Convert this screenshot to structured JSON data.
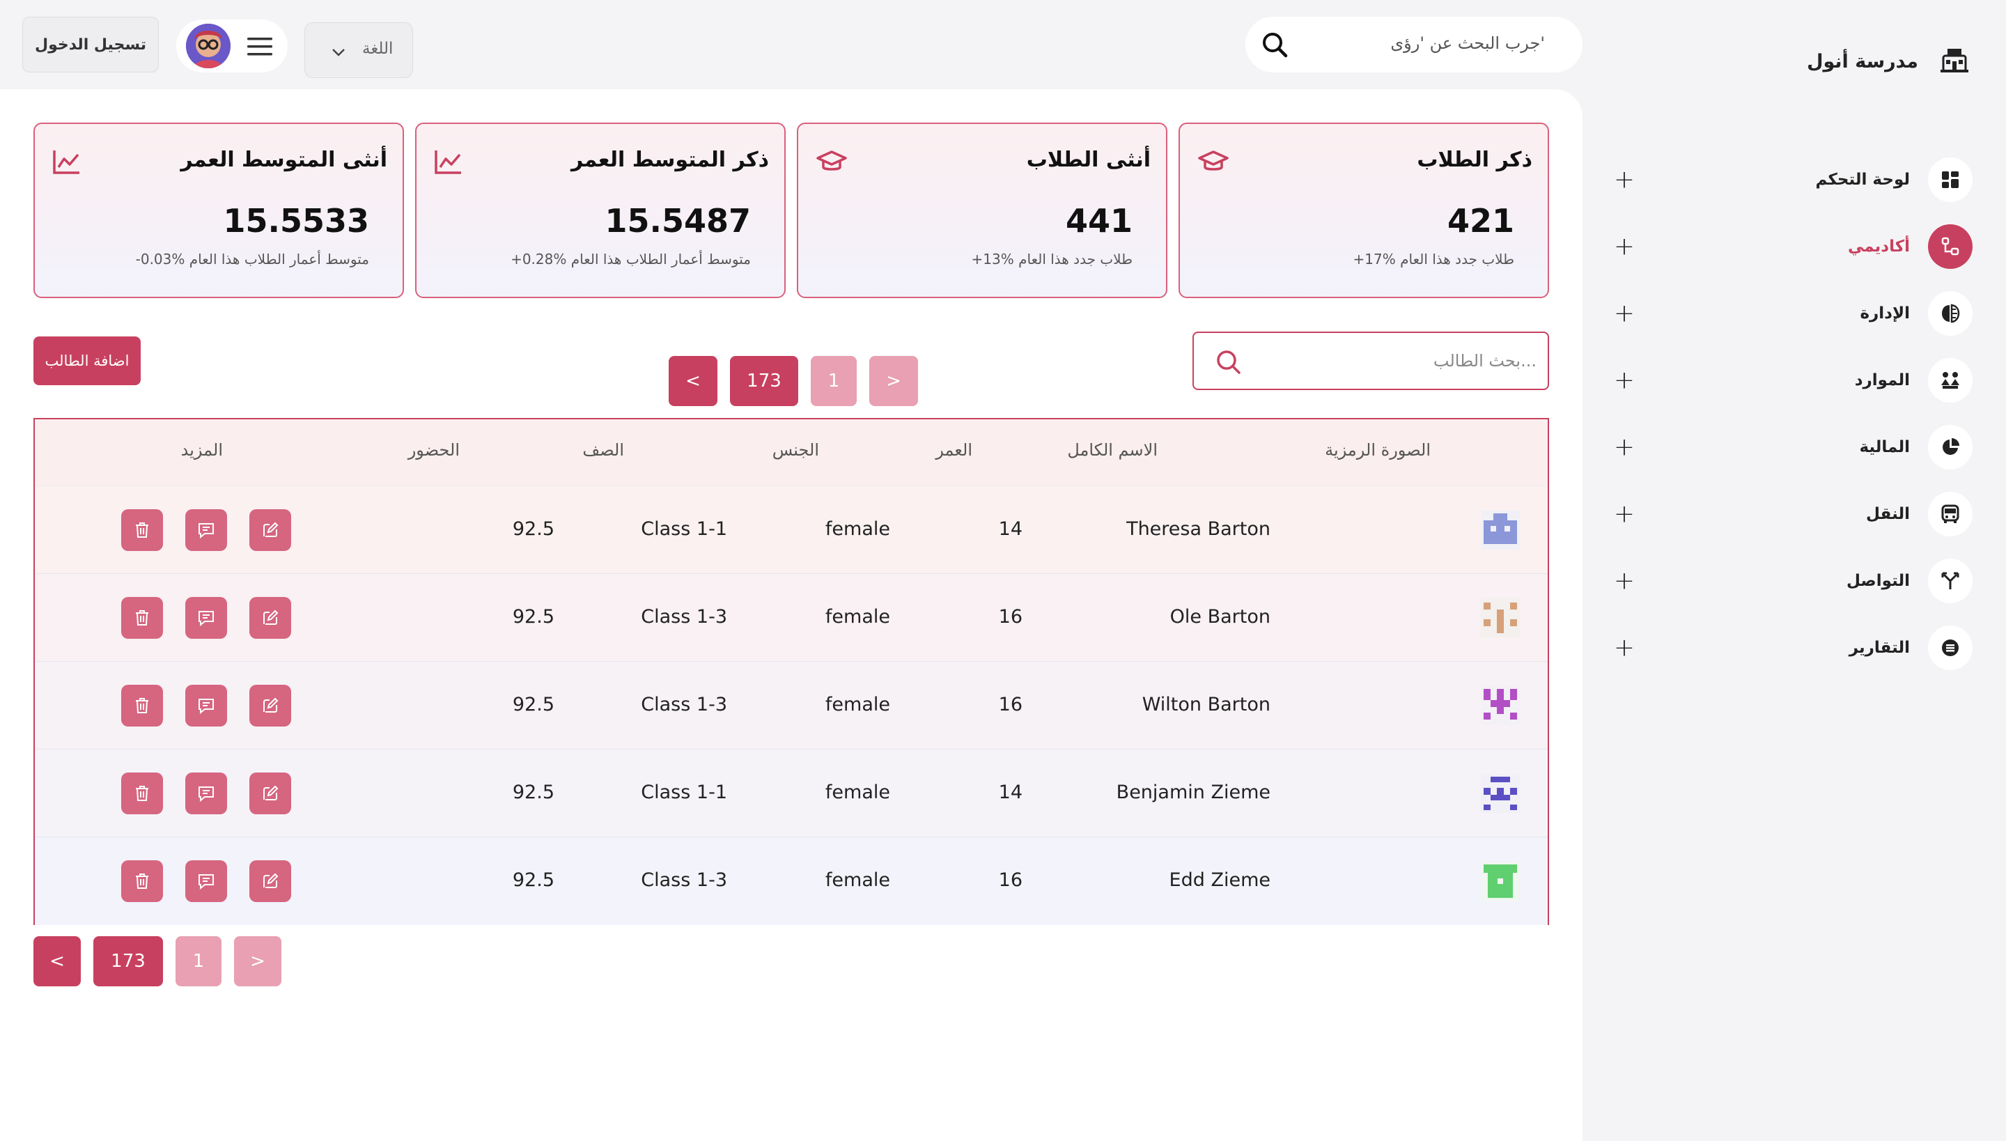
{
  "sidebar": {
    "brand_name": "مدرسة أنول",
    "items": [
      {
        "label": "لوحة التحكم",
        "icon": "dashboard-icon",
        "active": false
      },
      {
        "label": "أكاديمي",
        "icon": "academic-icon",
        "active": true
      },
      {
        "label": "الإدارة",
        "icon": "administration-icon",
        "active": false
      },
      {
        "label": "الموارد",
        "icon": "resources-icon",
        "active": false
      },
      {
        "label": "المالية",
        "icon": "finance-pie-icon",
        "active": false
      },
      {
        "label": "النقل",
        "icon": "bus-icon",
        "active": false
      },
      {
        "label": "التواصل",
        "icon": "communication-icon",
        "active": false
      },
      {
        "label": "التقارير",
        "icon": "reports-icon",
        "active": false
      }
    ]
  },
  "topbar": {
    "search_placeholder": "جرب البحث عن 'رؤى'",
    "language_label": "اللغة",
    "login_label": "تسجيل الدخول"
  },
  "cards": [
    {
      "title": "ذكر الطلاب",
      "value": "421",
      "sub": "+17% طلاب جدد هذا العام",
      "icon": "graduation-cap-icon"
    },
    {
      "title": "أنثى الطلاب",
      "value": "441",
      "sub": "+13% طلاب جدد هذا العام",
      "icon": "graduation-cap-icon"
    },
    {
      "title": "ذكر المتوسط العمر",
      "value": "15.5487",
      "sub": "+0.28% متوسط أعمار الطلاب هذا العام",
      "icon": "line-chart-icon"
    },
    {
      "title": "أنثى المتوسط العمر",
      "value": "15.5533",
      "sub": "-0.03% متوسط أعمار الطلاب هذا العام",
      "icon": "line-chart-icon"
    }
  ],
  "students": {
    "search_placeholder": "بحث الطالب...",
    "add_label": "اضافة الطالب",
    "pagination": {
      "prev": "<",
      "total": "173",
      "current": "1",
      "next": ">"
    },
    "columns": {
      "avatar": "الصورة الرمزية",
      "name": "الاسم الكامل",
      "age": "العمر",
      "gender": "الجنس",
      "class": "الصف",
      "attendance": "الحضور",
      "more": "المزيد"
    },
    "rows": [
      {
        "name": "Theresa Barton",
        "age": "14",
        "gender": "female",
        "class": "Class 1-1",
        "attendance": "92.5",
        "avatar_color": "#8b97d8"
      },
      {
        "name": "Ole Barton",
        "age": "16",
        "gender": "female",
        "class": "Class 1-3",
        "attendance": "92.5",
        "avatar_color": "#d6a07a"
      },
      {
        "name": "Wilton Barton",
        "age": "16",
        "gender": "female",
        "class": "Class 1-3",
        "attendance": "92.5",
        "avatar_color": "#b24fc4"
      },
      {
        "name": "Benjamin Zieme",
        "age": "14",
        "gender": "female",
        "class": "Class 1-1",
        "attendance": "92.5",
        "avatar_color": "#5b4fc4"
      },
      {
        "name": "Edd Zieme",
        "age": "16",
        "gender": "female",
        "class": "Class 1-3",
        "attendance": "92.5",
        "avatar_color": "#5fcf6f"
      }
    ]
  },
  "colors": {
    "accent": "#c8405f",
    "accent_light": "#e8a0b2",
    "action": "#d66580"
  }
}
